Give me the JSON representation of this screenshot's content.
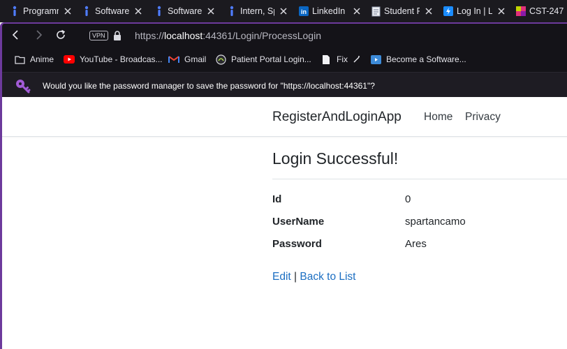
{
  "tabs": [
    {
      "label": "Programm",
      "icon": "indeed-icon"
    },
    {
      "label": "Software",
      "icon": "indeed-icon"
    },
    {
      "label": "Software",
      "icon": "indeed-icon"
    },
    {
      "label": "Intern, Sp",
      "icon": "indeed-icon"
    },
    {
      "label": "LinkedIn",
      "icon": "linkedin-icon"
    },
    {
      "label": "Student P",
      "icon": "document-icon"
    },
    {
      "label": "Log In | L",
      "icon": "bolt-icon"
    },
    {
      "label": "CST-247",
      "icon": "grid-logo-icon"
    }
  ],
  "addressbar": {
    "vpn": "VPN",
    "url_prefix": "https://",
    "url_host": "localhost",
    "url_rest": ":44361/Login/ProcessLogin"
  },
  "bookmarks": [
    {
      "label": "Anime",
      "icon": "folder-icon"
    },
    {
      "label": "YouTube - Broadcas...",
      "icon": "youtube-icon"
    },
    {
      "label": "Gmail",
      "icon": "gmail-icon"
    },
    {
      "label": "Patient Portal Login...",
      "icon": "portal-icon"
    },
    {
      "label": "Fix",
      "icon": "page-icon"
    },
    {
      "label": "Become a Software...",
      "icon": "video-icon"
    }
  ],
  "password_prompt": "Would you like the password manager to save the password for \"https://localhost:44361\"?",
  "site": {
    "brand": "RegisterAndLoginApp",
    "nav": [
      "Home",
      "Privacy"
    ],
    "heading": "Login Successful!",
    "details": [
      {
        "label": "Id",
        "value": "0"
      },
      {
        "label": "UserName",
        "value": "spartancamo"
      },
      {
        "label": "Password",
        "value": "Ares"
      }
    ],
    "edit_link": "Edit",
    "separator": "|",
    "back_link": "Back to List"
  },
  "colors": {
    "chrome_bg": "#141318",
    "private_frame": "#6d3a9c",
    "link": "#1b6ec2",
    "key_icon": "#a25bd6"
  }
}
